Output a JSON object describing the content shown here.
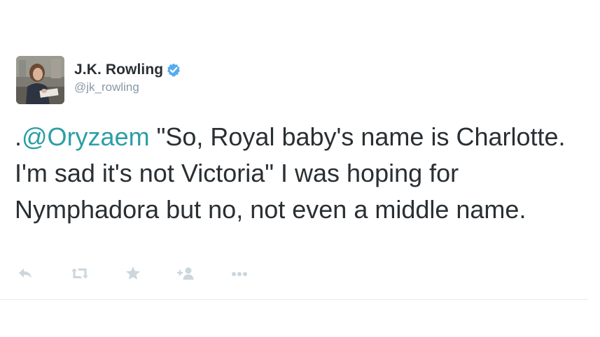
{
  "author": {
    "display_name": "J.K. Rowling",
    "handle": "@jk_rowling",
    "verified": true,
    "avatar_icon": "profile-photo"
  },
  "tweet": {
    "prefix": ".",
    "mention": "@Oryzaem",
    "body": " \"So, Royal baby's name is Charlotte. I'm sad it's not Victoria\" I was hoping for Nymphadora but no, not even a middle name."
  },
  "actions": [
    {
      "name": "reply",
      "icon": "reply-icon"
    },
    {
      "name": "retweet",
      "icon": "retweet-icon"
    },
    {
      "name": "favorite",
      "icon": "star-icon"
    },
    {
      "name": "follow",
      "icon": "follow-icon"
    },
    {
      "name": "more",
      "icon": "more-icon"
    }
  ],
  "colors": {
    "mention": "#2b9ea5",
    "text": "#292f33",
    "muted": "#8899a6",
    "verified": "#55acee",
    "action_icons": "#ccd6dd"
  }
}
